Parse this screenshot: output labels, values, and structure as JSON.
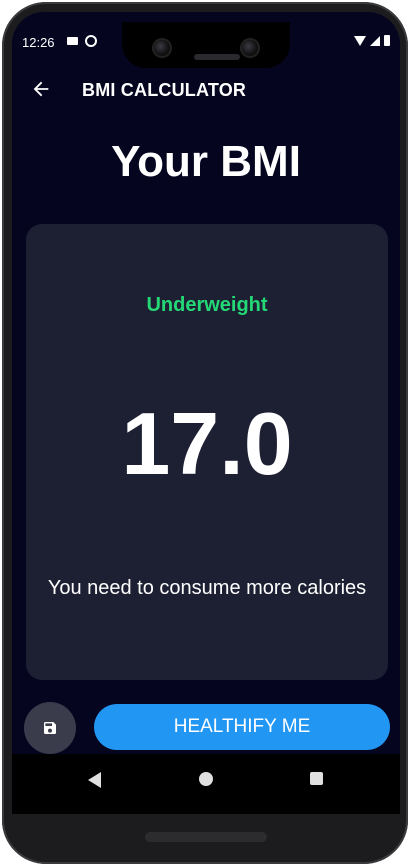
{
  "status_bar": {
    "time": "12:26"
  },
  "app_bar": {
    "title": "BMI CALCULATOR",
    "back_icon": "arrow-back-icon"
  },
  "page": {
    "title": "Your BMI"
  },
  "result": {
    "status": "Underweight",
    "status_color": "#24d876",
    "value": "17.0",
    "message": "You need to consume more calories"
  },
  "actions": {
    "save_icon": "save-icon",
    "primary_label": "HEALTHIFY ME",
    "primary_color": "#2196f3"
  },
  "colors": {
    "background": "#050520",
    "card": "#1d2033"
  }
}
